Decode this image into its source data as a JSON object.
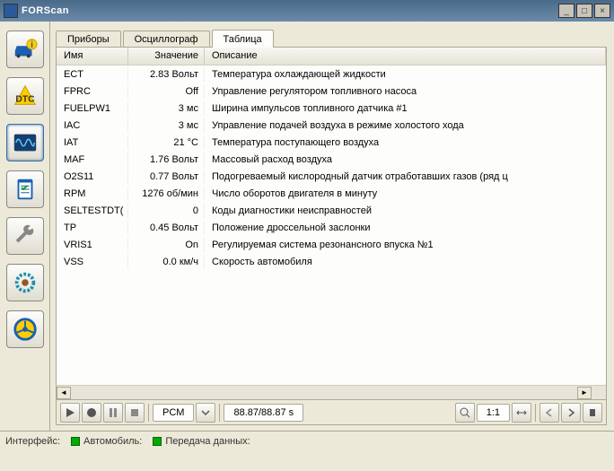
{
  "window": {
    "title": "FORScan"
  },
  "tabs": [
    {
      "label": "Приборы"
    },
    {
      "label": "Осциллограф"
    },
    {
      "label": "Таблица"
    }
  ],
  "activeTab": 2,
  "columns": {
    "name": "Имя",
    "value": "Значение",
    "desc": "Описание"
  },
  "rows": [
    {
      "name": "ECT",
      "value": "2.83 Вольт",
      "desc": "Температура охлаждающей жидкости"
    },
    {
      "name": "FPRC",
      "value": "Off",
      "desc": "Управление регулятором топливного насоса"
    },
    {
      "name": "FUELPW1",
      "value": "3 мс",
      "desc": "Ширина импульсов топливного датчика #1"
    },
    {
      "name": "IAC",
      "value": "3 мс",
      "desc": "Управление подачей воздуха в режиме холостого хода"
    },
    {
      "name": "IAT",
      "value": "21 °C",
      "desc": "Температура поступающего воздуха"
    },
    {
      "name": "MAF",
      "value": "1.76 Вольт",
      "desc": "Массовый расход воздуха"
    },
    {
      "name": "O2S11",
      "value": "0.77 Вольт",
      "desc": "Подогреваемый кислородный датчик отработавших газов (ряд ц"
    },
    {
      "name": "RPM",
      "value": "1276 об/мин",
      "desc": "Число оборотов двигателя в минуту"
    },
    {
      "name": "SELTESTDT(",
      "value": "0",
      "desc": "Коды диагностики неисправностей"
    },
    {
      "name": "TP",
      "value": "0.45 Вольт",
      "desc": "Положение дроссельной заслонки"
    },
    {
      "name": "VRIS1",
      "value": "On",
      "desc": "Регулируемая система резонансного впуска №1"
    },
    {
      "name": "VSS",
      "value": "0.0 км/ч",
      "desc": "Скорость автомобиля"
    }
  ],
  "toolbar": {
    "module": "PCM",
    "time": "88.87/88.87 s",
    "ratio": "1:1"
  },
  "status": {
    "iface": "Интерфейс:",
    "car": "Автомобиль:",
    "data": "Передача данных:"
  }
}
